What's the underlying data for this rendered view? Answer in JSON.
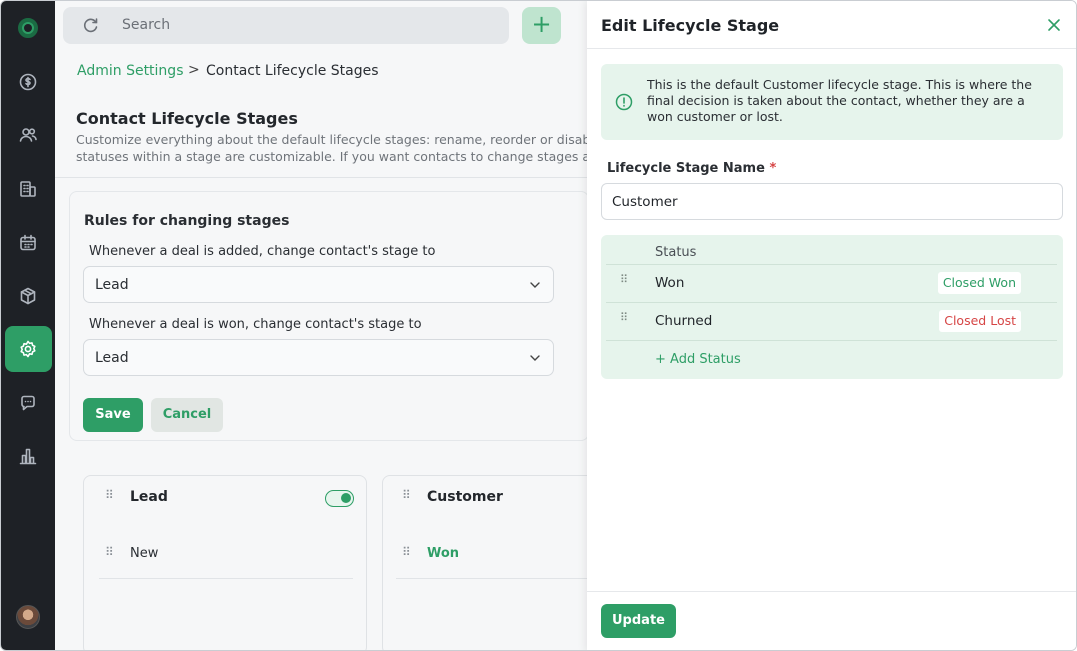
{
  "search": {
    "placeholder": "Search"
  },
  "topbar": {
    "add_label": "+"
  },
  "breadcrumb": {
    "parent": "Admin Settings",
    "separator": ">",
    "current": "Contact Lifecycle Stages"
  },
  "page": {
    "title": "Contact Lifecycle Stages",
    "description_line1": "Customize everything about the default lifecycle stages: rename, reorder or disable the",
    "description_line2": "statuses within a stage are customizable. If you want contacts to change stages autom"
  },
  "rules": {
    "title": "Rules for changing stages",
    "rule1_label": "Whenever a deal is added, change contact's stage to",
    "rule1_value": "Lead",
    "rule2_label": "Whenever a deal is won, change contact's stage to",
    "rule2_value": "Lead",
    "save_label": "Save",
    "cancel_label": "Cancel"
  },
  "stages": [
    {
      "name": "Lead",
      "enabled": true,
      "items": [
        "New"
      ]
    },
    {
      "name": "Customer",
      "items": [
        "Won"
      ]
    }
  ],
  "drawer": {
    "title": "Edit Lifecycle Stage",
    "info": "This is the default Customer lifecycle stage. This is where the final decision is taken about the contact, whether they are a won customer or lost.",
    "field_label": "Lifecycle Stage Name",
    "required_mark": "*",
    "field_value": "Customer",
    "status_header": "Status",
    "statuses": [
      {
        "name": "Won",
        "type": "Closed Won"
      },
      {
        "name": "Churned",
        "type": "Closed Lost"
      }
    ],
    "add_status_label": "+ Add Status",
    "update_label": "Update"
  },
  "colors": {
    "accent": "#2e9e66",
    "danger": "#d64545",
    "sidebar": "#1e2126"
  }
}
